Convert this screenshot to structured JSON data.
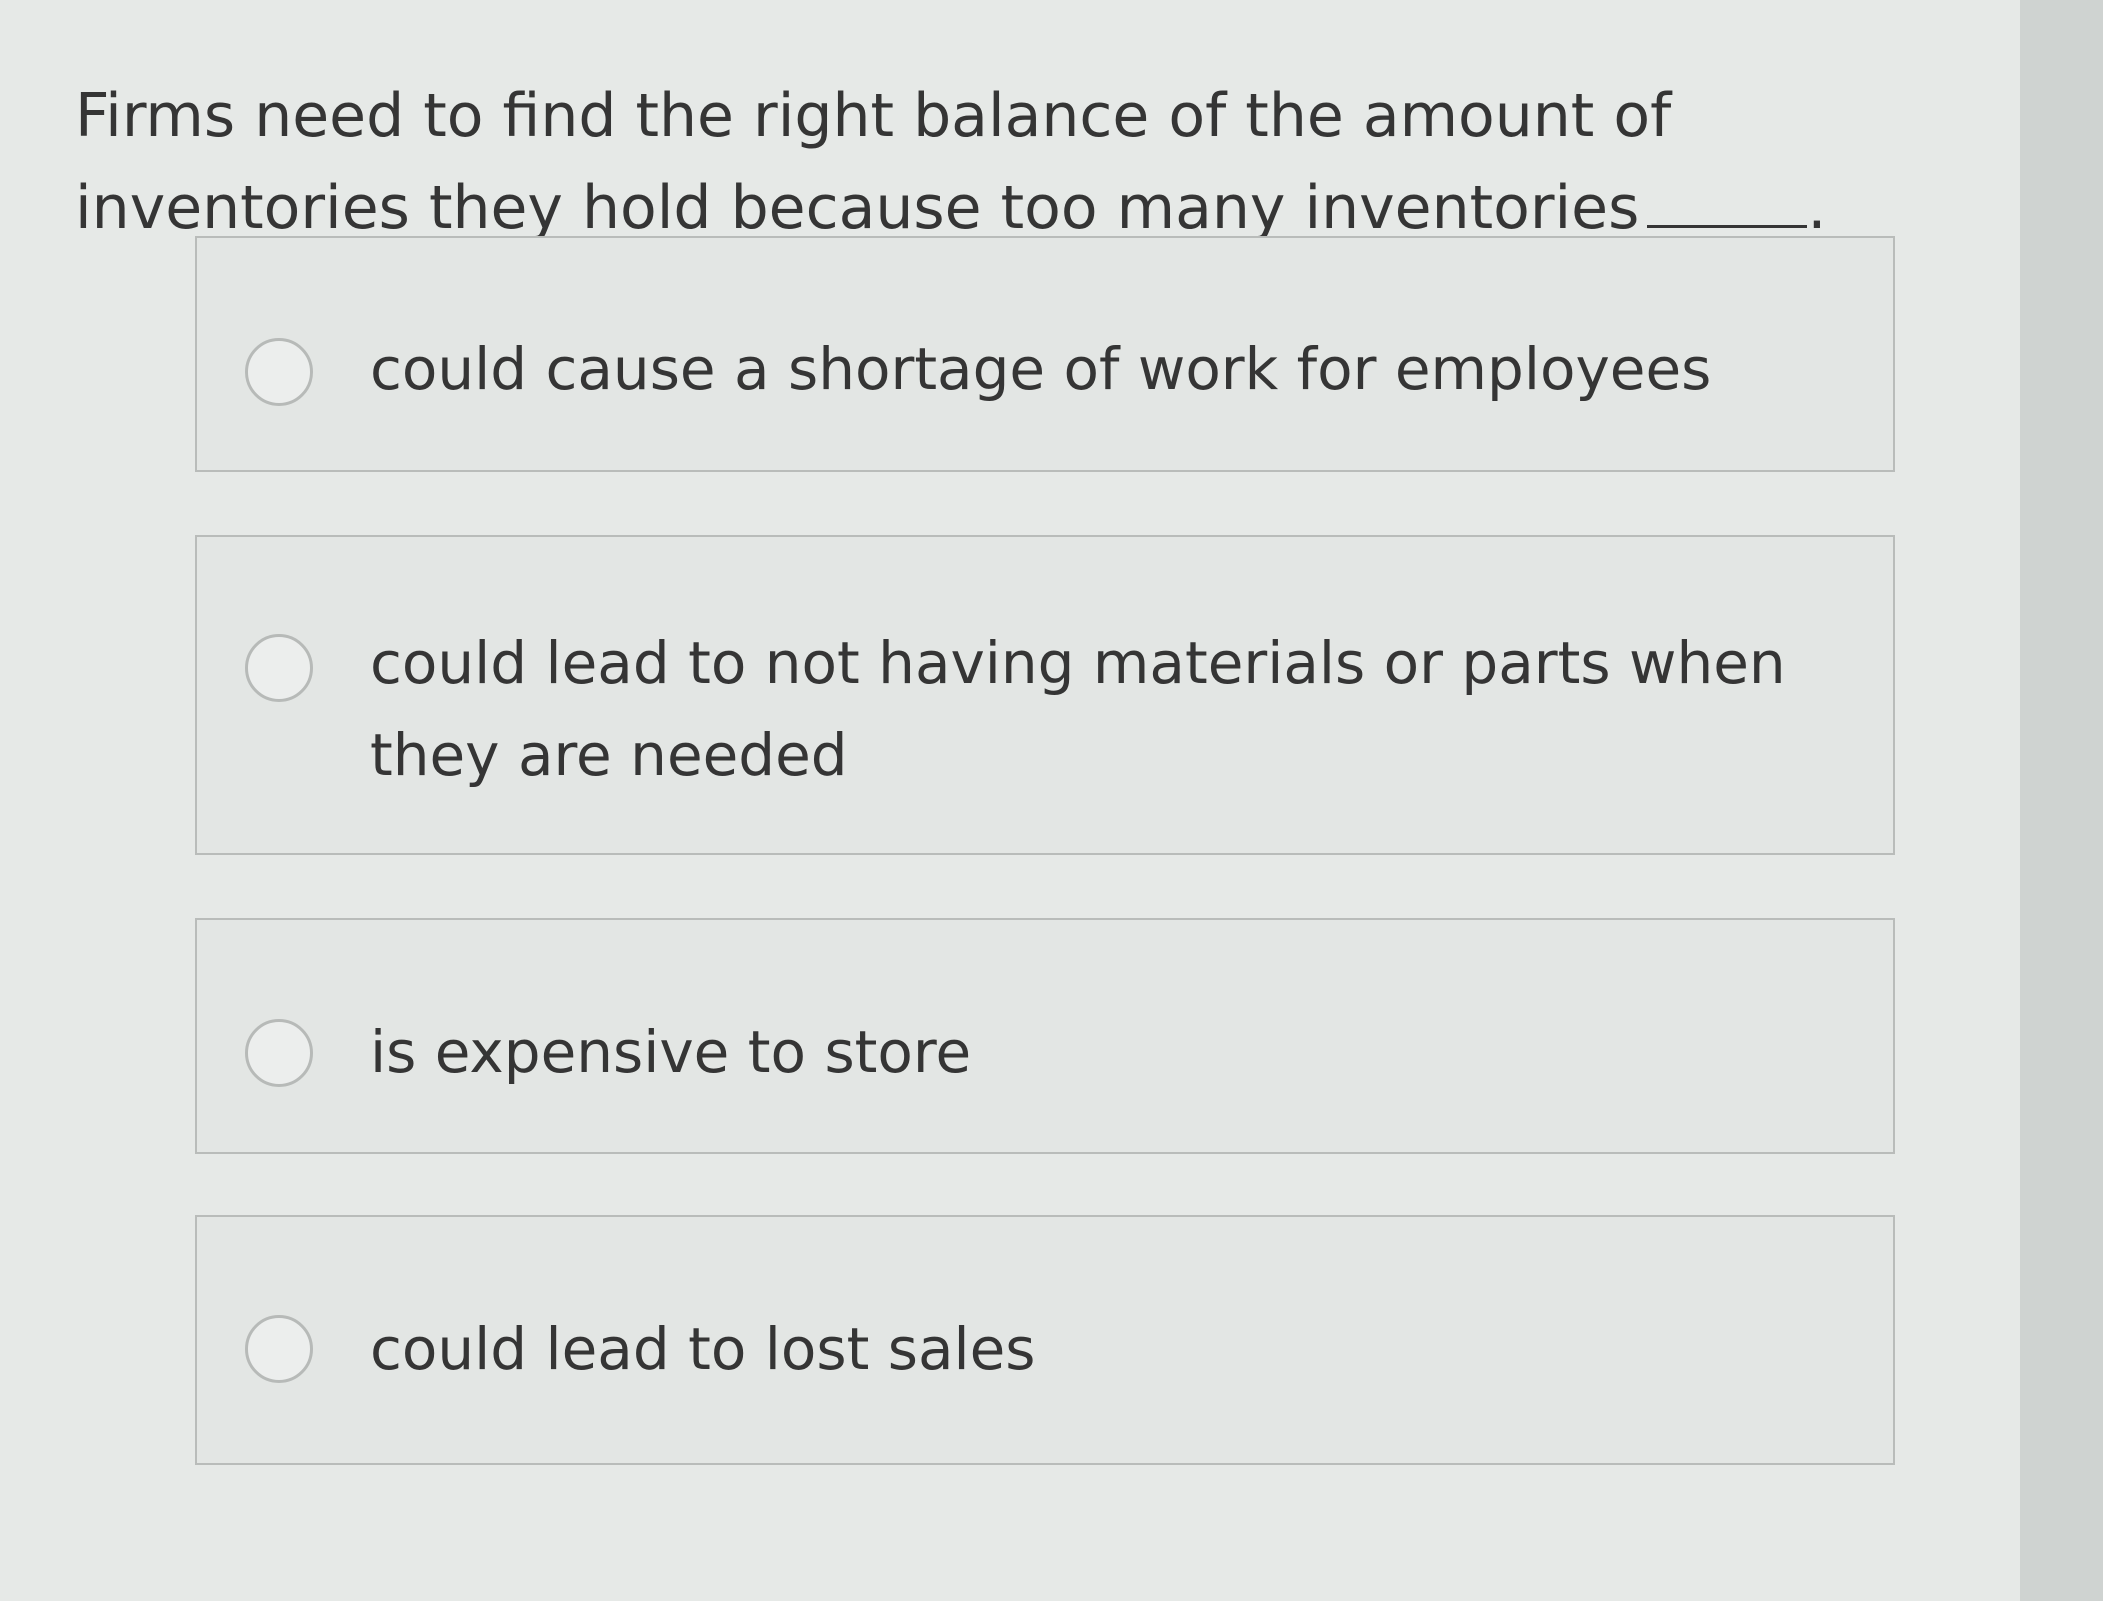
{
  "question": {
    "text": "Firms need to find the right balance of the amount of inventories they hold because too many inventories",
    "blank_suffix": "."
  },
  "options": [
    {
      "label": "could cause a shortage of work for employees",
      "selected": false
    },
    {
      "label": "could lead to not having materials or parts when they are needed",
      "selected": false
    },
    {
      "label": "is expensive to store",
      "selected": false
    },
    {
      "label": "could lead to lost sales",
      "selected": false
    }
  ]
}
